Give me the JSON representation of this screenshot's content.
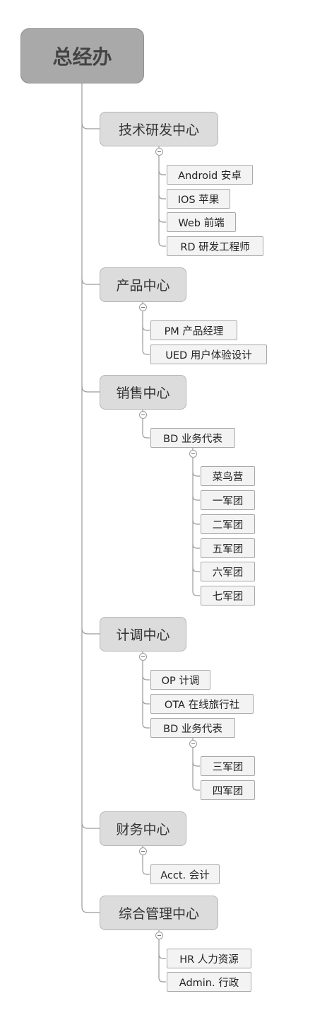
{
  "root": "总经办",
  "centers": [
    {
      "title": "技术研发中心",
      "items": [
        {
          "label": "Android 安卓"
        },
        {
          "label": "IOS 苹果"
        },
        {
          "label": "Web 前端"
        },
        {
          "label": "RD 研发工程师"
        }
      ]
    },
    {
      "title": "产品中心",
      "items": [
        {
          "label": "PM 产品经理"
        },
        {
          "label": "UED 用户体验设计"
        }
      ]
    },
    {
      "title": "销售中心",
      "items": [
        {
          "label": "BD 业务代表",
          "children": [
            "菜鸟营",
            "一军团",
            "二军团",
            "五军团",
            "六军团",
            "七军团"
          ]
        }
      ]
    },
    {
      "title": "计调中心",
      "items": [
        {
          "label": "OP 计调"
        },
        {
          "label": "OTA 在线旅行社"
        },
        {
          "label": "BD 业务代表",
          "children": [
            "三军团",
            "四军团"
          ]
        }
      ]
    },
    {
      "title": "财务中心",
      "items": [
        {
          "label": "Acct. 会计"
        }
      ]
    },
    {
      "title": "综合管理中心",
      "items": [
        {
          "label": "HR 人力资源"
        },
        {
          "label": "Admin. 行政"
        }
      ]
    }
  ]
}
